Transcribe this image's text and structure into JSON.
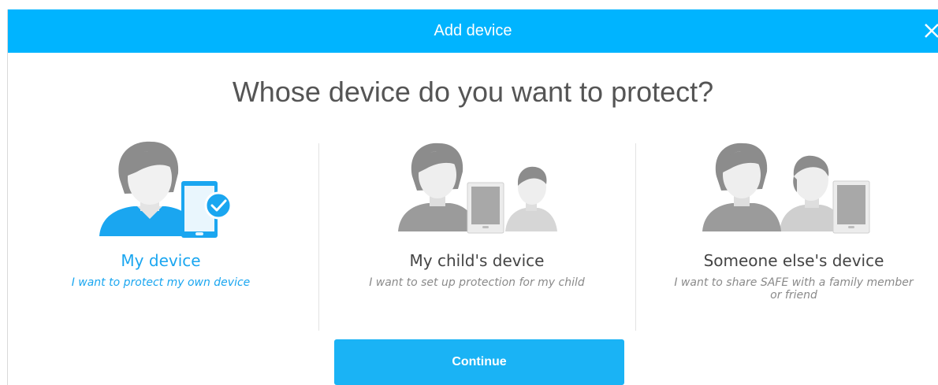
{
  "dialog": {
    "title": "Add device",
    "close_icon": "close-icon"
  },
  "question": "Whose device do you want to protect?",
  "options": [
    {
      "title": "My device",
      "description": "I want to protect my own device",
      "selected": true
    },
    {
      "title": "My child's device",
      "description": "I want to set up protection for my child",
      "selected": false
    },
    {
      "title": "Someone else's device",
      "description": "I want to share SAFE with a family member or friend",
      "selected": false
    }
  ],
  "continue_label": "Continue",
  "colors": {
    "accent": "#00b4ff",
    "selected_text": "#1aa6f0",
    "muted_text": "#8a8a8a",
    "figure_gray": "#8c8c8c"
  }
}
